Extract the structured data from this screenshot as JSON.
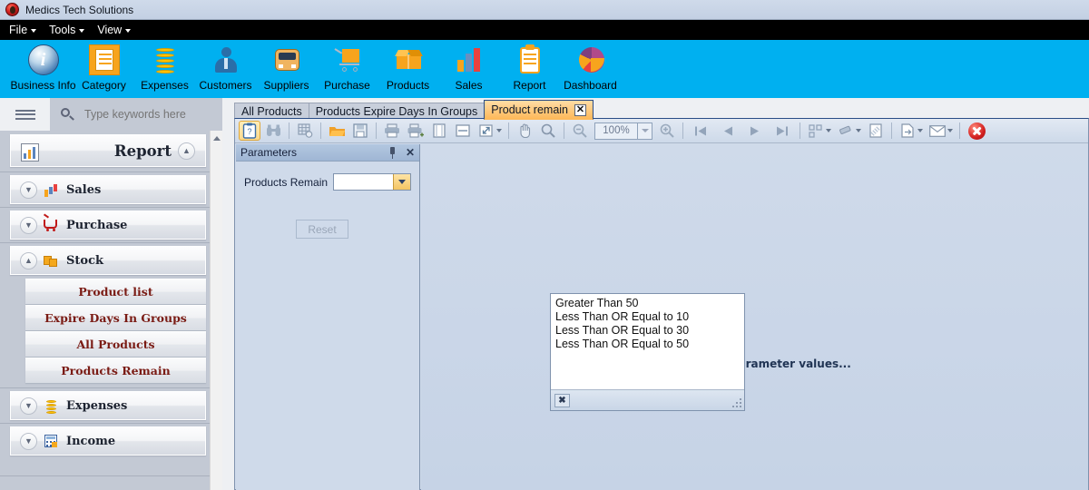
{
  "titlebar": {
    "app_name": "Medics Tech Solutions",
    "logo_icon": "app-logo-icon"
  },
  "menubar": {
    "items": [
      {
        "label": "File"
      },
      {
        "label": "Tools"
      },
      {
        "label": "View"
      }
    ]
  },
  "ribbon": {
    "background": "#00b0f0",
    "buttons": [
      {
        "label": "Business Info",
        "icon": "info-icon"
      },
      {
        "label": "Category",
        "icon": "category-icon"
      },
      {
        "label": "Expenses",
        "icon": "coins-icon"
      },
      {
        "label": "Customers",
        "icon": "person-icon"
      },
      {
        "label": "Suppliers",
        "icon": "bus-icon"
      },
      {
        "label": "Purchase",
        "icon": "cart-icon"
      },
      {
        "label": "Products",
        "icon": "box-icon"
      },
      {
        "label": "Sales",
        "icon": "bar-chart-icon"
      },
      {
        "label": "Report",
        "icon": "clipboard-icon"
      },
      {
        "label": "Dashboard",
        "icon": "pie-chart-icon"
      }
    ]
  },
  "sidebar": {
    "menu_icon": "hamburger-icon",
    "search": {
      "placeholder": "Type keywords here",
      "value": "",
      "icon": "search-icon"
    },
    "header": {
      "label": "Report",
      "icon": "report-icon",
      "expanded": true
    },
    "groups": [
      {
        "label": "Sales",
        "icon": "bar-chart-icon",
        "expanded": false
      },
      {
        "label": "Purchase",
        "icon": "cart-icon",
        "expanded": false
      },
      {
        "label": "Stock",
        "icon": "stock-icon",
        "expanded": true
      },
      {
        "label": "Expenses",
        "icon": "coins-icon",
        "expanded": false
      },
      {
        "label": "Income",
        "icon": "calculator-icon",
        "expanded": false
      }
    ],
    "stock_items": [
      {
        "label": "Product list"
      },
      {
        "label": "Expire Days In Groups"
      },
      {
        "label": "All Products"
      },
      {
        "label": "Products Remain"
      }
    ]
  },
  "tabs": [
    {
      "label": "All Products",
      "active": false,
      "closable": false
    },
    {
      "label": "Products Expire Days In Groups",
      "active": false,
      "closable": false
    },
    {
      "label": "Product remain",
      "active": true,
      "closable": true,
      "close_icon": "close-icon"
    }
  ],
  "report_toolbar": {
    "zoom_value": "100%",
    "buttons": [
      {
        "name": "parameters-toggle",
        "icon": "clipboard-parameters-icon",
        "active": true
      },
      {
        "name": "search-document",
        "icon": "binoculars-icon",
        "active": false
      },
      {
        "name": "thumbnails",
        "icon": "grid-settings-icon",
        "active": false
      },
      {
        "name": "open",
        "icon": "folder-open-icon",
        "active": false
      },
      {
        "name": "save",
        "icon": "floppy-save-icon",
        "active": false
      },
      {
        "name": "print",
        "icon": "printer-icon",
        "active": false
      },
      {
        "name": "quick-print",
        "icon": "printer-quick-icon",
        "active": false
      },
      {
        "name": "page-setup",
        "icon": "page-setup-icon",
        "active": false
      },
      {
        "name": "header-footer",
        "icon": "header-footer-icon",
        "active": false
      },
      {
        "name": "scale",
        "icon": "scale-icon",
        "active": false
      },
      {
        "name": "hand-tool",
        "icon": "hand-icon",
        "active": false
      },
      {
        "name": "magnifier",
        "icon": "magnifier-icon",
        "active": false
      },
      {
        "name": "zoom-out",
        "icon": "zoom-out-icon",
        "active": false
      },
      {
        "name": "zoom-in",
        "icon": "zoom-in-icon",
        "active": false
      },
      {
        "name": "first-page",
        "icon": "first-page-icon",
        "active": false
      },
      {
        "name": "previous-page",
        "icon": "previous-page-icon",
        "active": false
      },
      {
        "name": "next-page",
        "icon": "next-page-icon",
        "active": false
      },
      {
        "name": "last-page",
        "icon": "last-page-icon",
        "active": false
      },
      {
        "name": "multiple-pages",
        "icon": "multiple-pages-icon",
        "active": false
      },
      {
        "name": "page-color",
        "icon": "paint-icon",
        "active": false
      },
      {
        "name": "watermark",
        "icon": "watermark-icon",
        "active": false
      },
      {
        "name": "export-document",
        "icon": "export-icon",
        "active": false
      },
      {
        "name": "send-email",
        "icon": "envelope-icon",
        "active": false
      },
      {
        "name": "close-preview",
        "icon": "close-red-icon",
        "active": false
      }
    ]
  },
  "parameters_panel": {
    "title": "Parameters",
    "pin_icon": "pin-icon",
    "close_icon": "close-icon",
    "field": {
      "label": "Products Remain",
      "value": "",
      "dropdown_icon": "chevron-down-icon"
    },
    "reset_label": "Reset",
    "reset_enabled": false
  },
  "dropdown": {
    "open": true,
    "clear_icon": "clear-selection-icon",
    "resize_grip_icon": "resize-grip-icon",
    "options": [
      "Greater Than 50",
      "Less Than OR Equal to  10",
      "Less Than OR Equal to  30",
      "Less Than OR Equal to  50"
    ]
  },
  "report_view": {
    "status_text": "Waiting for parameter values..."
  },
  "colors": {
    "ribbon": "#00b0f0",
    "accent_orange": "#f7a41d",
    "sidebar_link": "#7a1b14",
    "active_tab": "#fdb95a",
    "panel_blue": "#cfdaea"
  }
}
